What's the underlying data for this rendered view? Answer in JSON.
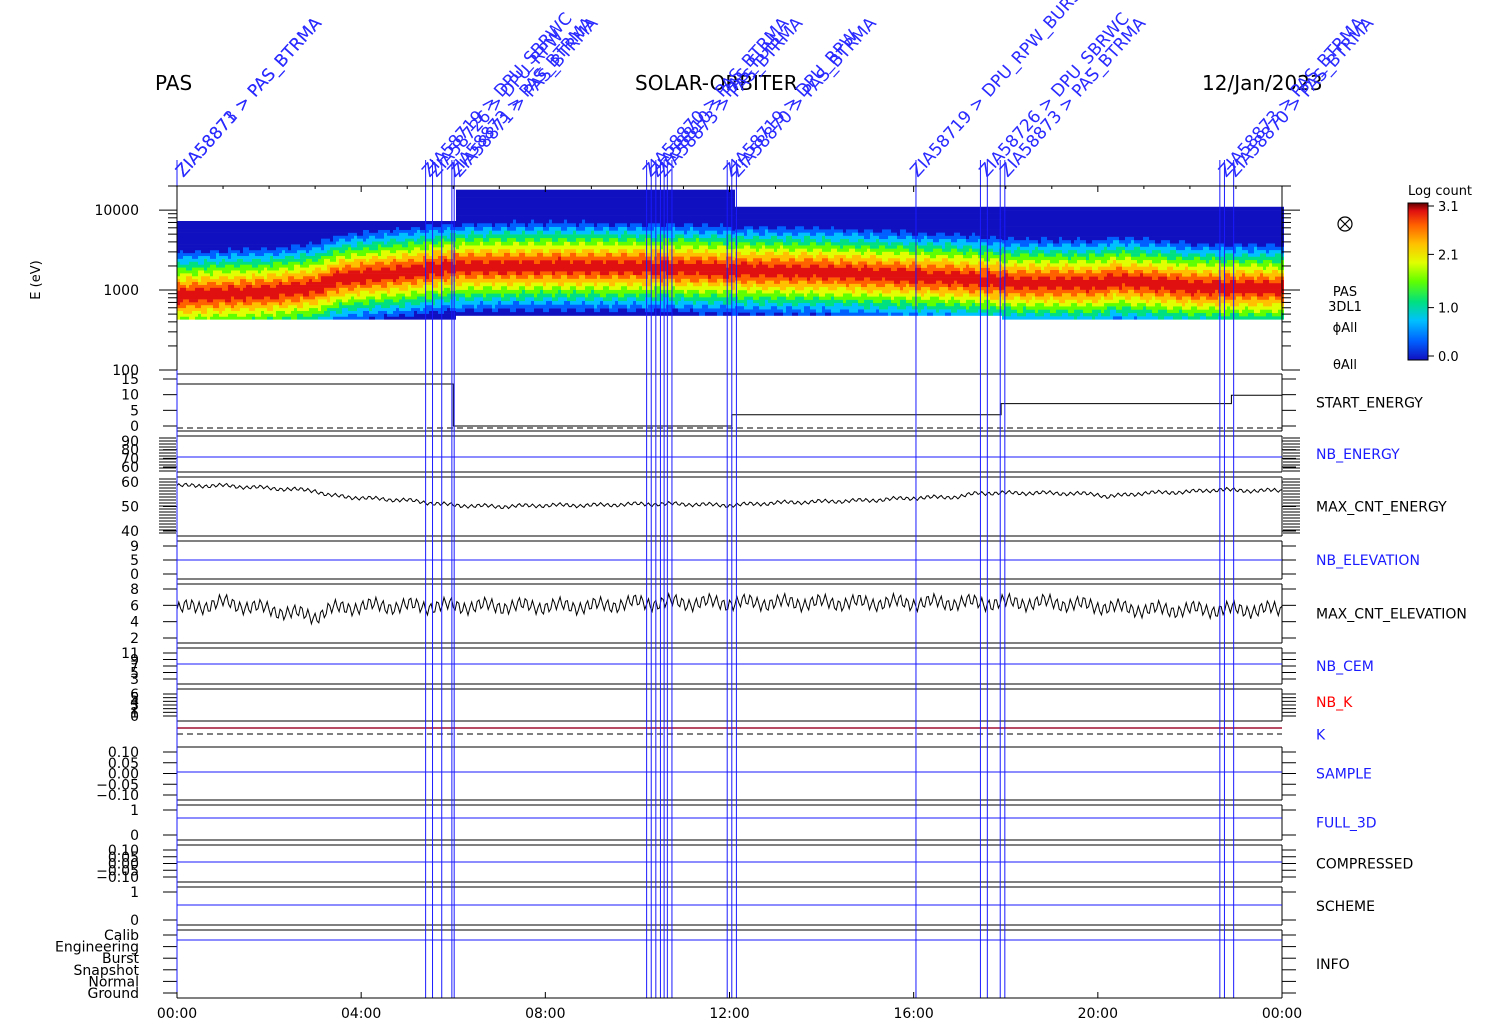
{
  "header": {
    "instrument": "PAS",
    "mission": "SOLAR-ORBITER",
    "date": "12/Jan/2023"
  },
  "colors": {
    "axis": "#000000",
    "event_line": "#1a1aff",
    "event_label": "#2a2aff",
    "red_label": "#ff0000",
    "k_line": "#a01030"
  },
  "colorbar": {
    "title": "Log count",
    "ticks": [
      "3.1",
      "2.1",
      "1.0",
      "0.0"
    ],
    "values": [
      3.1,
      2.1,
      1.0,
      0.0
    ],
    "palette": [
      "#1010c0",
      "#0060ff",
      "#00c0ff",
      "#00e080",
      "#60ff00",
      "#e0ff00",
      "#ffc000",
      "#ff6000",
      "#e01010",
      "#600000"
    ]
  },
  "chart_data": {
    "type": "heatmap",
    "x_axis": {
      "range_hours": [
        0,
        24
      ],
      "ticks": [
        0,
        4,
        8,
        12,
        16,
        20,
        24
      ],
      "tick_labels": [
        "00:00",
        "04:00",
        "08:00",
        "12:00",
        "16:00",
        "20:00",
        "00:00"
      ]
    },
    "spectrogram": {
      "ylabel": "E (eV)",
      "yscale": "log",
      "ylim": [
        100,
        20000
      ],
      "y_ticks": [
        100,
        1000,
        10000
      ],
      "y_tick_labels": [
        "100",
        "1000",
        "10000"
      ],
      "side_labels": [
        "PAS",
        "3DL1",
        "ϕAll",
        "θAll"
      ],
      "peak_energy_profile": {
        "hours": [
          0,
          1,
          2,
          3,
          3.5,
          5,
          6,
          8,
          10,
          12,
          14,
          16,
          17.5,
          18,
          20,
          20.3,
          22,
          24
        ],
        "energy_eV": [
          850,
          900,
          950,
          1100,
          1400,
          1700,
          1950,
          2000,
          1950,
          1800,
          1700,
          1500,
          1350,
          1250,
          1200,
          1350,
          1100,
          1050
        ]
      }
    },
    "panels": [
      {
        "name": "START_ENERGY",
        "color": "#000000",
        "tick_labels": [
          "15",
          "10",
          "5",
          "0"
        ]
      },
      {
        "name": "NB_ENERGY",
        "color": "#1a1aff",
        "tick_labels": [
          "90",
          "80",
          "70",
          "60"
        ]
      },
      {
        "name": "MAX_CNT_ENERGY",
        "color": "#000000",
        "tick_labels": [
          "60",
          "50",
          "40"
        ]
      },
      {
        "name": "NB_ELEVATION",
        "color": "#1a1aff",
        "tick_labels": [
          "9",
          "5",
          "0"
        ]
      },
      {
        "name": "MAX_CNT_ELEVATION",
        "color": "#000000",
        "tick_labels": [
          "8",
          "6",
          "4",
          "2"
        ]
      },
      {
        "name": "NB_CEM",
        "color": "#1a1aff",
        "tick_labels": [
          "11",
          "9",
          "7",
          "5",
          "3"
        ]
      },
      {
        "name": "NB_K",
        "color": "#ff0000",
        "tick_labels": [
          "6",
          "5",
          "4",
          "3",
          "2",
          "1",
          "0"
        ]
      },
      {
        "name": "K",
        "color": "#1a1aff",
        "tick_labels": []
      },
      {
        "name": "SAMPLE",
        "color": "#1a1aff",
        "tick_labels": [
          "0.10",
          "0.05",
          "0.00",
          "−0.05",
          "−0.10"
        ]
      },
      {
        "name": "FULL_3D",
        "color": "#1a1aff",
        "tick_labels": [
          "1",
          "0"
        ]
      },
      {
        "name": "COMPRESSED",
        "color": "#000000",
        "tick_labels": [
          "0.10",
          "0.05",
          "0.00",
          "−0.05",
          "−0.10"
        ]
      },
      {
        "name": "SCHEME",
        "color": "#000000",
        "tick_labels": [
          "1",
          "0"
        ]
      },
      {
        "name": "INFO",
        "color": "#000000",
        "tick_labels": [
          "Calib",
          "Engineering",
          "Burst",
          "Snapshot",
          "Normal",
          "Ground"
        ]
      }
    ],
    "series": [
      {
        "name": "MAX_CNT_ENERGY",
        "hours": [
          0,
          1,
          2,
          3,
          3.3,
          4,
          5,
          6,
          7,
          8,
          9,
          10,
          11,
          12,
          13,
          14,
          15,
          16,
          17,
          17.4,
          18,
          19,
          20,
          20.2,
          21,
          22,
          22.7,
          23,
          24
        ],
        "values": [
          58.5,
          58.5,
          57.5,
          56.5,
          54.5,
          53.5,
          52.5,
          50.5,
          50,
          50.5,
          50.5,
          51,
          51,
          50.5,
          51.5,
          52,
          52.5,
          53.5,
          54,
          55.5,
          55.5,
          55.5,
          55,
          54,
          55.5,
          56,
          57,
          56.5,
          56.5
        ]
      },
      {
        "name": "MAX_CNT_ELEVATION",
        "hours": [
          0,
          1,
          2,
          3,
          3.3,
          4,
          5,
          5.5,
          6,
          7,
          8,
          9,
          10,
          11,
          12,
          13,
          14,
          15,
          16,
          17,
          18,
          19,
          20,
          21,
          22,
          23,
          24
        ],
        "values": [
          5,
          6,
          5,
          4,
          5,
          5.5,
          5.5,
          5.5,
          5.5,
          5.5,
          5.5,
          5.5,
          6,
          6,
          6,
          6,
          6,
          6,
          6,
          6,
          6,
          6,
          5.5,
          5,
          5,
          5,
          5
        ]
      },
      {
        "name": "START_ENERGY",
        "hours": [
          0,
          6,
          6,
          12.05,
          12.05,
          17.9,
          17.9,
          22.9,
          22.9,
          24
        ],
        "values": [
          15,
          15,
          0,
          0,
          4,
          4,
          8,
          8,
          11,
          11
        ]
      },
      {
        "name": "K",
        "hours": [
          0,
          24
        ],
        "values": [
          1,
          1
        ]
      }
    ],
    "event_hours": [
      0,
      5.4,
      5.55,
      5.75,
      5.97,
      6.02,
      10.2,
      10.3,
      10.4,
      10.5,
      10.58,
      10.65,
      10.75,
      11.95,
      12.05,
      12.15,
      16.05,
      17.45,
      17.6,
      17.88,
      17.98,
      22.65,
      22.75,
      22.95
    ],
    "event_labels": [
      {
        "hour": 0.05,
        "text": "ZIA58873 > PAS_BTRMA"
      },
      {
        "hour": 0.05,
        "text": "ZIA58871 > PAS_BTRMA"
      },
      {
        "hour": 5.4,
        "text": "ZIA58719 > DPU_SBRWC"
      },
      {
        "hour": 5.55,
        "text": "ZIA58726 > DPU_RPW"
      },
      {
        "hour": 5.95,
        "text": "ZIA58873 > PAS_BTRMA"
      },
      {
        "hour": 6.05,
        "text": "ZIA58871 > PAS_BTRMA"
      },
      {
        "hour": 10.2,
        "text": "ZIA58870 > PAS_BTRMA"
      },
      {
        "hour": 10.35,
        "text": "ZIA58810 > PAS_FULL"
      },
      {
        "hour": 10.5,
        "text": "ZIA58873 > PAS_BTRMA"
      },
      {
        "hour": 11.95,
        "text": "ZIA58719 > DPU_RPW"
      },
      {
        "hour": 12.1,
        "text": "ZIA58870 > PAS_BTRMA"
      },
      {
        "hour": 16.0,
        "text": "ZIA58719 > DPU_RPW_BURST"
      },
      {
        "hour": 17.5,
        "text": "ZIA58726 > DPU_SBRWC"
      },
      {
        "hour": 17.95,
        "text": "ZIA58873 > PAS_BTRMA"
      },
      {
        "hour": 22.7,
        "text": "ZIA58873 > PAS_BTRMA"
      },
      {
        "hour": 22.9,
        "text": "ZIA58870 > PAS_BTRMA"
      }
    ]
  }
}
